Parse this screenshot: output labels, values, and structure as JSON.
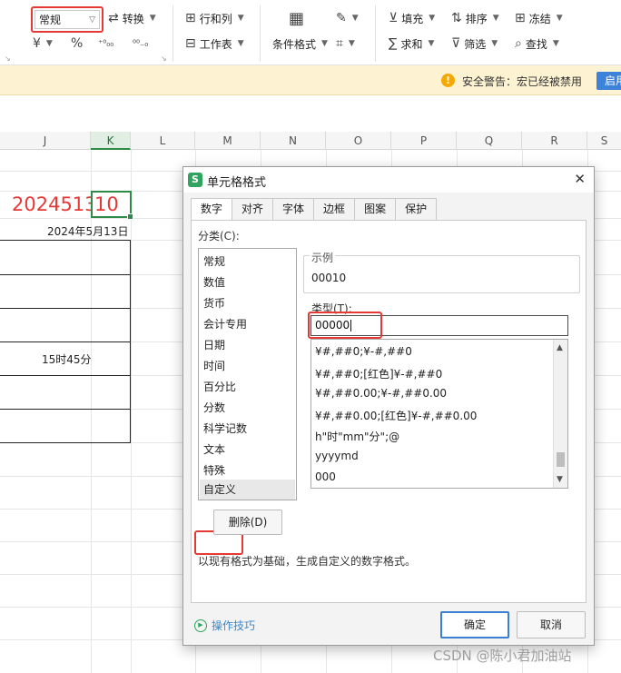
{
  "ribbon": {
    "number_format": "常规",
    "convert": "转换",
    "rows_cols": "行和列",
    "worksheet": "工作表",
    "conditional_format": "条件格式",
    "fill": "填充",
    "sort": "排序",
    "freeze": "冻结",
    "sum": "求和",
    "filter": "筛选",
    "find": "查找",
    "currency_symbol": "¥",
    "percent_symbol": "%"
  },
  "security": {
    "warning": "安全警告：宏已经被禁用",
    "enable": "启用"
  },
  "sheet": {
    "columns": [
      "J",
      "K",
      "L",
      "M",
      "N",
      "O",
      "P",
      "Q",
      "R",
      "S"
    ],
    "active_column": "K",
    "j_value": "2024513",
    "k_value": "10",
    "date_text": "2024年5月13日",
    "time_text": "15时45分"
  },
  "dialog": {
    "title": "单元格格式",
    "tabs": [
      "数字",
      "对齐",
      "字体",
      "边框",
      "图案",
      "保护"
    ],
    "category_label": "分类(C):",
    "categories": [
      "常规",
      "数值",
      "货币",
      "会计专用",
      "日期",
      "时间",
      "百分比",
      "分数",
      "科学记数",
      "文本",
      "特殊",
      "自定义"
    ],
    "sample_label": "示例",
    "sample_value": "00010",
    "type_label": "类型(T):",
    "type_value": "00000",
    "formats": [
      "¥#,##0;¥-#,##0",
      "¥#,##0;[红色]¥-#,##0",
      "¥#,##0.00;¥-#,##0.00",
      "¥#,##0.00;[红色]¥-#,##0.00",
      "h\"时\"mm\"分\";@",
      "yyyymd",
      "000"
    ],
    "delete_button": "删除(D)",
    "hint": "以现有格式为基础，生成自定义的数字格式。",
    "tips": "操作技巧",
    "ok": "确定",
    "cancel": "取消"
  },
  "watermark": "CSDN @陈小君加油站"
}
